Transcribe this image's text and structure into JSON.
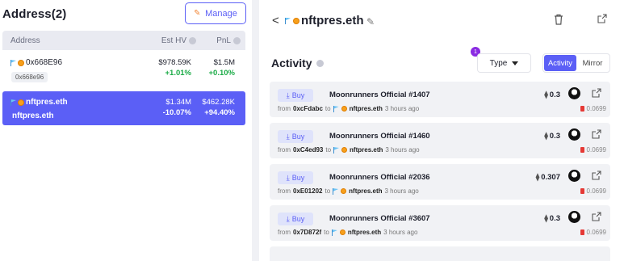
{
  "left": {
    "title": "Address(2)",
    "manage_label": "Manage",
    "columns": {
      "address": "Address",
      "est_hv": "Est HV",
      "pnl": "PnL"
    },
    "rows": [
      {
        "name": "0x668E96",
        "badge": "0x668e96",
        "est_hv": "$978.59K",
        "est_hv_pct": "+1.01%",
        "pnl": "$1.5M",
        "pnl_pct": "+0.10%",
        "selected": false
      },
      {
        "name": "nftpres.eth",
        "sub": "nftpres.eth",
        "est_hv": "$1.34M",
        "est_hv_pct": "-10.07%",
        "pnl": "$462.28K",
        "pnl_pct": "+94.40%",
        "selected": true
      }
    ]
  },
  "right": {
    "back_glyph": "<",
    "title": "nftpres.eth",
    "activity_title": "Activity",
    "filter_badge": "1",
    "type_label": "Type",
    "toggle": {
      "activity": "Activity",
      "mirror": "Mirror"
    },
    "rows": [
      {
        "tag": "Buy",
        "name": "Moonrunners Official #1407",
        "from": "0xcFdabc",
        "to_word": "to",
        "to": "nftpres.eth",
        "time": "3 hours ago",
        "price": "0.3",
        "gas": "0.0699"
      },
      {
        "tag": "Buy",
        "name": "Moonrunners Official #1460",
        "from": "0xC4ed93",
        "to_word": "to",
        "to": "nftpres.eth",
        "time": "3 hours ago",
        "price": "0.3",
        "gas": "0.0699"
      },
      {
        "tag": "Buy",
        "name": "Moonrunners Official #2036",
        "from": "0xE01202",
        "to_word": "to",
        "to": "nftpres.eth",
        "time": "3 hours ago",
        "price": "0.307",
        "gas": "0.0699"
      },
      {
        "tag": "Buy",
        "name": "Moonrunners Official #3607",
        "from": "0x7D872f",
        "to_word": "to",
        "to": "nftpres.eth",
        "time": "3 hours ago",
        "price": "0.3",
        "gas": "0.0699"
      }
    ],
    "from_word": "from"
  },
  "colors": {
    "accent": "#5b5ff6",
    "positive": "#1aab46",
    "gas": "#e53935"
  },
  "icons": [
    "pencil-icon",
    "info-icon",
    "flag-icon",
    "coin-icon",
    "back-chevron-icon",
    "edit-icon",
    "trash-icon",
    "external-link-icon",
    "caret-down-icon",
    "buy-arrow-icon",
    "eth-icon",
    "avatar",
    "gas-pump-icon"
  ]
}
